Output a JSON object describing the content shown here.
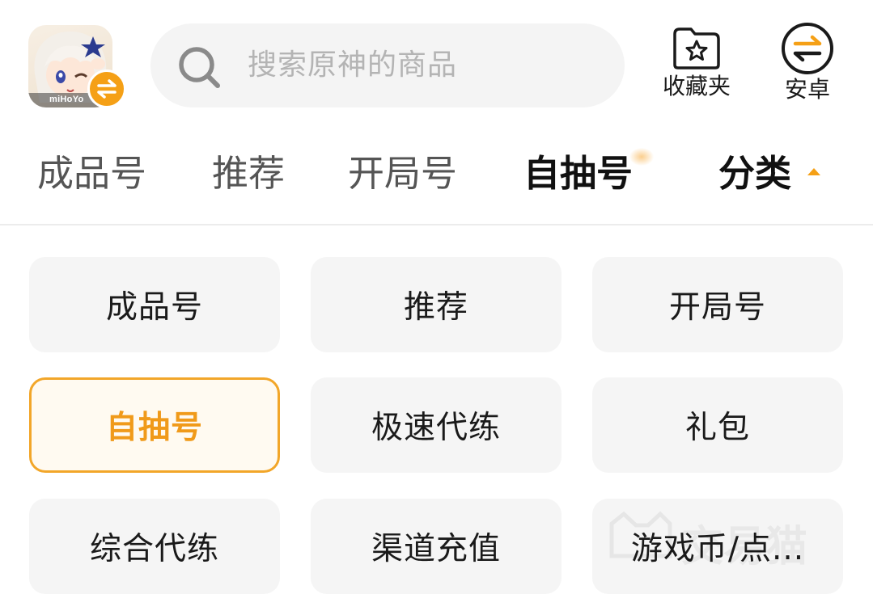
{
  "header": {
    "game_icon_brand": "miHoYo",
    "search_placeholder": "搜索原神的商品",
    "favorites_label": "收藏夹",
    "android_label": "安卓",
    "accent_color": "#f5a016"
  },
  "tabs": [
    {
      "label": "成品号",
      "active": false
    },
    {
      "label": "推荐",
      "active": false
    },
    {
      "label": "开局号",
      "active": false
    },
    {
      "label": "自抽号",
      "active": true
    }
  ],
  "category_tab": {
    "label": "分类",
    "expanded": true
  },
  "categories": [
    {
      "label": "成品号",
      "selected": false
    },
    {
      "label": "推荐",
      "selected": false
    },
    {
      "label": "开局号",
      "selected": false
    },
    {
      "label": "自抽号",
      "selected": true
    },
    {
      "label": "极速代练",
      "selected": false
    },
    {
      "label": "礼包",
      "selected": false
    },
    {
      "label": "综合代练",
      "selected": false
    },
    {
      "label": "渠道充值",
      "selected": false
    },
    {
      "label": "游戏币/点...",
      "selected": false
    }
  ],
  "watermark_text": "交易猫"
}
